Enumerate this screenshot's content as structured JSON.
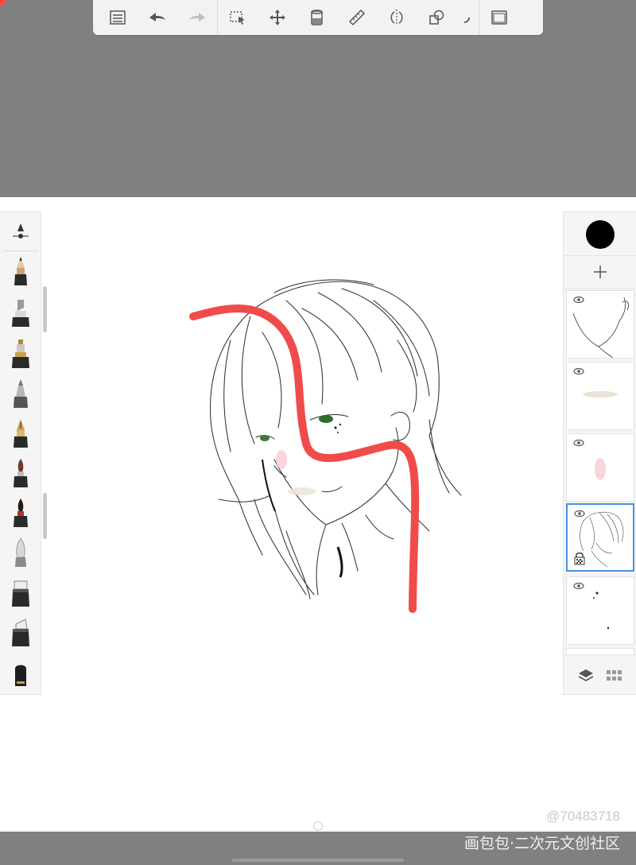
{
  "toolbar": {
    "icons": [
      "layers-list-icon",
      "undo-icon",
      "redo-icon",
      "selection-icon",
      "transform-icon",
      "fill-icon",
      "ruler-icon",
      "symmetry-icon",
      "shapes-icon",
      "more-icon",
      "fullscreen-icon"
    ]
  },
  "colors": {
    "stroke": "#f04b4b",
    "current_color": "#000000",
    "accent": "#4a90e2",
    "ui_bg": "#808080"
  },
  "brushes": [
    "brush-size-slider",
    "pencil",
    "marker",
    "ink-pen",
    "airbrush",
    "fountain-pen",
    "paint-brush",
    "watercolor-brush",
    "smudge",
    "eraser-hard",
    "eraser-soft",
    "fill-bucket-brush"
  ],
  "layers": {
    "count": 5,
    "active_index": 3,
    "items": [
      "layer-face-outline",
      "layer-skin-highlight",
      "layer-blush",
      "layer-hair-line-art",
      "layer-dots"
    ]
  },
  "watermark": {
    "id_text": "@70483718",
    "site_text": "画包包·二次元文创社区"
  }
}
